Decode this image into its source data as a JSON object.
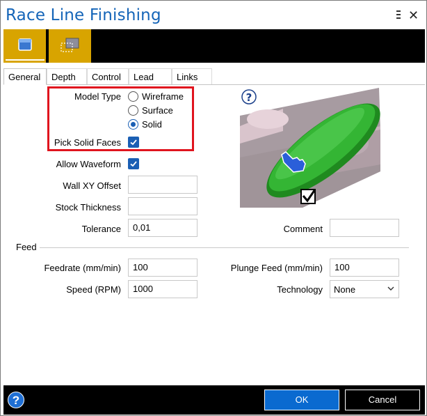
{
  "window": {
    "title": "Race Line Finishing"
  },
  "tabs": [
    {
      "label": "General"
    },
    {
      "label": "Depth"
    },
    {
      "label": "Control"
    },
    {
      "label": "Lead"
    },
    {
      "label": "Links"
    }
  ],
  "general": {
    "model_type_label": "Model Type",
    "model_type_options": [
      "Wireframe",
      "Surface",
      "Solid"
    ],
    "model_type_selected": "Solid",
    "pick_solid_faces_label": "Pick Solid Faces",
    "pick_solid_faces_checked": true,
    "allow_waveform_label": "Allow Waveform",
    "allow_waveform_checked": true,
    "wall_xy_offset_label": "Wall XY Offset",
    "wall_xy_offset_value": "",
    "stock_thickness_label": "Stock Thickness",
    "stock_thickness_value": "",
    "tolerance_label": "Tolerance",
    "tolerance_value": "0,01",
    "comment_label": "Comment",
    "comment_value": ""
  },
  "feed": {
    "group_label": "Feed",
    "feedrate_label": "Feedrate (mm/min)",
    "feedrate_value": "100",
    "plunge_feed_label": "Plunge Feed (mm/min)",
    "plunge_feed_value": "100",
    "speed_label": "Speed (RPM)",
    "speed_value": "1000",
    "technology_label": "Technology",
    "technology_value": "None"
  },
  "footer": {
    "ok_label": "OK",
    "cancel_label": "Cancel"
  },
  "colors": {
    "accent": "#1a5fb4",
    "toolbar_button": "#d8a400",
    "highlight": "#e0141e",
    "title": "#1565b8"
  }
}
